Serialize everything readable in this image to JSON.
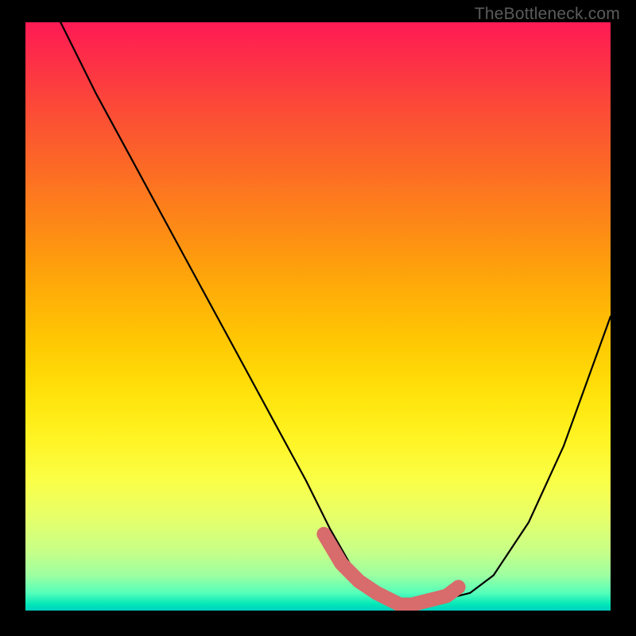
{
  "attribution": "TheBottleneck.com",
  "chart_data": {
    "type": "line",
    "title": "",
    "xlabel": "",
    "ylabel": "",
    "xlim": [
      0,
      100
    ],
    "ylim": [
      0,
      100
    ],
    "series": [
      {
        "name": "bottleneck-curve",
        "x": [
          6,
          12,
          18,
          24,
          30,
          36,
          42,
          48,
          52,
          56,
          60,
          64,
          68,
          72,
          76,
          80,
          86,
          92,
          100
        ],
        "values": [
          100,
          88,
          77,
          66,
          55,
          44,
          33,
          22,
          14,
          7,
          3,
          1,
          1,
          2,
          3,
          6,
          15,
          28,
          50
        ]
      }
    ],
    "highlight": {
      "name": "optimal-range",
      "x": [
        51,
        54,
        57,
        60,
        62,
        64,
        66,
        68,
        70,
        72,
        74
      ],
      "values": [
        13,
        8,
        5,
        3,
        2,
        1,
        1,
        1.5,
        2,
        2.5,
        4
      ]
    },
    "background_gradient": {
      "top_color": "#ff1a55",
      "bottom_color": "#00d0c0"
    }
  }
}
